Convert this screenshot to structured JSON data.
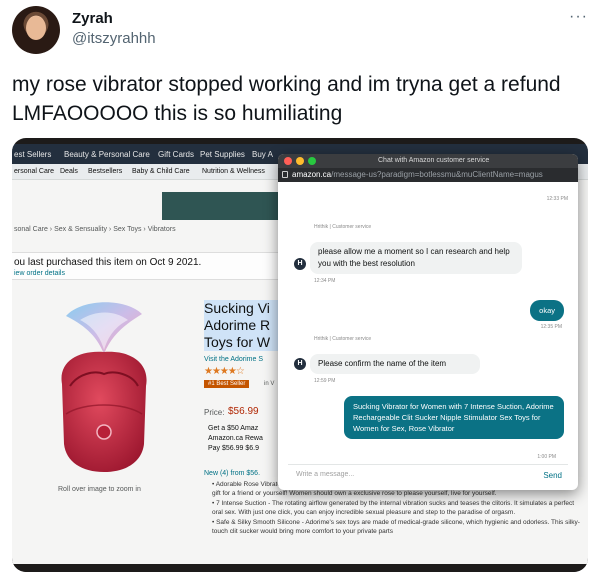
{
  "tweet": {
    "display_name": "Zyrah",
    "handle": "@itszyrahhh",
    "more": "···",
    "text": "my rose vibrator stopped working and im tryna get a refund LMFAOOOOO this is so humiliating"
  },
  "amazon": {
    "nav": [
      "est Sellers",
      "Beauty & Personal Care",
      "Gift Cards",
      "Pet Supplies",
      "Buy A"
    ],
    "subnav": [
      "ersonal Care",
      "Deals",
      "Bestsellers",
      "Baby & Child Care",
      "Nutrition & Wellness"
    ],
    "breadcrumb": "sonal Care › Sex & Sensuality › Sex Toys › Vibrators",
    "purchase_line": "ou last purchased this item on Oct 9 2021.",
    "order_details": "iew order details",
    "product_title": "Sucking Vi Adorime R Toys for W",
    "visit_store": "Visit the Adorime S",
    "stars": "★★★★☆",
    "best_seller": "#1 Best Seller",
    "best_in": "in V",
    "price_label": "Price:",
    "price": "$56.99",
    "offer_lines": [
      "Get a $50 Amaz",
      "Amazon.ca Rewa",
      "Pay $56.99 $6.9"
    ],
    "new_from": "New (4) from $56.",
    "roll_over": "Roll over image to zoom in",
    "bullets": [
      "• Adorable Rose Vibrator - Adorime clitoris sucking vibrator is shaped like a rose, which is adorable and romantic, it is the best gift for a friend or yourself! Women should own a exclusive rose to please yourself, live for yourself.",
      "• 7 Intense Suction - The rotating airflow generated by the internal vibration sucks and teases the clitoris. It simulates a perfect oral sex. With just one click, you can enjoy incredible sexual pleasure and step to the paradise of orgasm.",
      "• Safe & Silky Smooth Silicone - Adorime's sex toys are made of medical-grade silicone, which hygienic and odorless. This silky-touch clit sucker would bring more comfort to your private parts"
    ]
  },
  "chat": {
    "window_title": "Chat with Amazon customer service",
    "url_host": "amazon.ca",
    "url_path": "/message-us?paradigm=botlessmu&muClientName=magus",
    "timestamp_top": "12:33 PM",
    "agent_sender_1": "Hrithik | Customer service",
    "agent_msg_1": "please allow me a moment so I can research and help you with the best resolution",
    "agent_ts_1": "12:34 PM",
    "user_msg_1": "okay",
    "user_ts_1": "12:35 PM",
    "agent_sender_2": "Hrithik | Customer service",
    "agent_msg_2": "Please confirm the name of the item",
    "agent_ts_2": "12:59 PM",
    "user_msg_2": "Sucking Vibrator for Women with 7 Intense Suction, Adorime Rechargeable Clit Sucker Nipple Stimulator Sex Toys for Women for Sex, Rose Vibrator",
    "user_ts_2": "1:00 PM",
    "agent_initial": "H",
    "input_placeholder": "Write a message...",
    "send_label": "Send"
  },
  "colors": {
    "chat_bubble_user": "#0b7285",
    "amazon_nav": "#232f3e",
    "price": "#b12704",
    "product_rose": "#c8253f"
  }
}
